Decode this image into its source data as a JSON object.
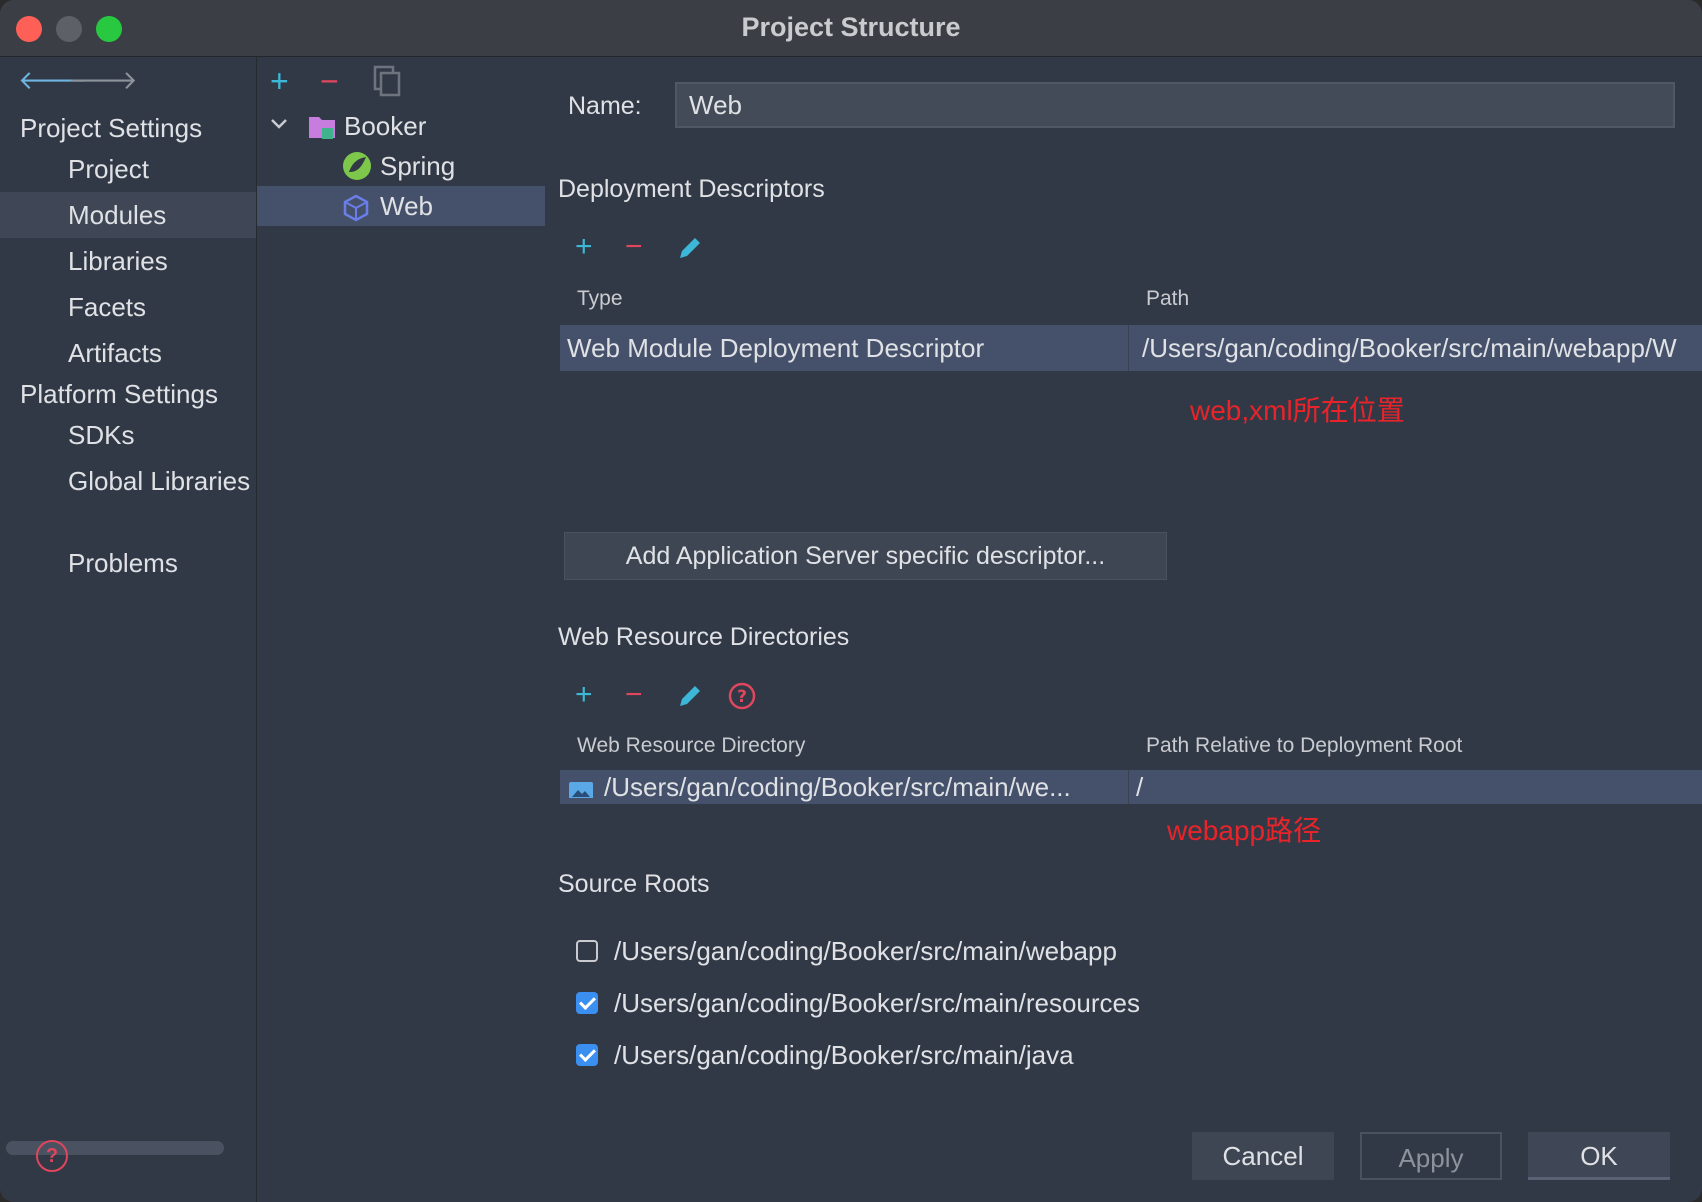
{
  "window": {
    "title": "Project Structure"
  },
  "sidebar": {
    "project_settings_title": "Project Settings",
    "items": [
      {
        "label": "Project"
      },
      {
        "label": "Modules"
      },
      {
        "label": "Libraries"
      },
      {
        "label": "Facets"
      },
      {
        "label": "Artifacts"
      }
    ],
    "platform_settings_title": "Platform Settings",
    "platform_items": [
      {
        "label": "SDKs"
      },
      {
        "label": "Global Libraries"
      }
    ],
    "problems": "Problems",
    "selected": "Modules"
  },
  "tree": {
    "toolbar": {
      "add": "+",
      "remove": "−"
    },
    "nodes": [
      {
        "label": "Booker",
        "icon": "module-folder-icon"
      },
      {
        "label": "Spring",
        "icon": "spring-icon"
      },
      {
        "label": "Web",
        "icon": "web-icon"
      }
    ],
    "selected": "Web"
  },
  "form": {
    "name_label": "Name:",
    "name_value": "Web"
  },
  "deployment": {
    "title": "Deployment Descriptors",
    "columns": [
      "Type",
      "Path"
    ],
    "rows": [
      {
        "type": "Web Module Deployment Descriptor",
        "path": "/Users/gan/coding/Booker/src/main/webapp/W"
      }
    ],
    "annotation": "web,xml所在位置",
    "add_server_button": "Add Application Server specific descriptor..."
  },
  "resources": {
    "title": "Web Resource Directories",
    "columns": [
      "Web Resource Directory",
      "Path Relative to Deployment Root"
    ],
    "rows": [
      {
        "directory": "/Users/gan/coding/Booker/src/main/we...",
        "relative": "/"
      }
    ],
    "annotation": "webapp路径"
  },
  "source_roots": {
    "title": "Source Roots",
    "items": [
      {
        "path": "/Users/gan/coding/Booker/src/main/webapp",
        "checked": false
      },
      {
        "path": "/Users/gan/coding/Booker/src/main/resources",
        "checked": true
      },
      {
        "path": "/Users/gan/coding/Booker/src/main/java",
        "checked": true
      }
    ]
  },
  "buttons": {
    "cancel": "Cancel",
    "apply": "Apply",
    "ok": "OK"
  },
  "colors": {
    "background": "#323946",
    "selection": "#45516a",
    "accent_cyan": "#3cb7d8",
    "remove_red": "#e0465e",
    "annotation_red": "#e8242a",
    "checkbox_blue": "#3b8ff0"
  }
}
